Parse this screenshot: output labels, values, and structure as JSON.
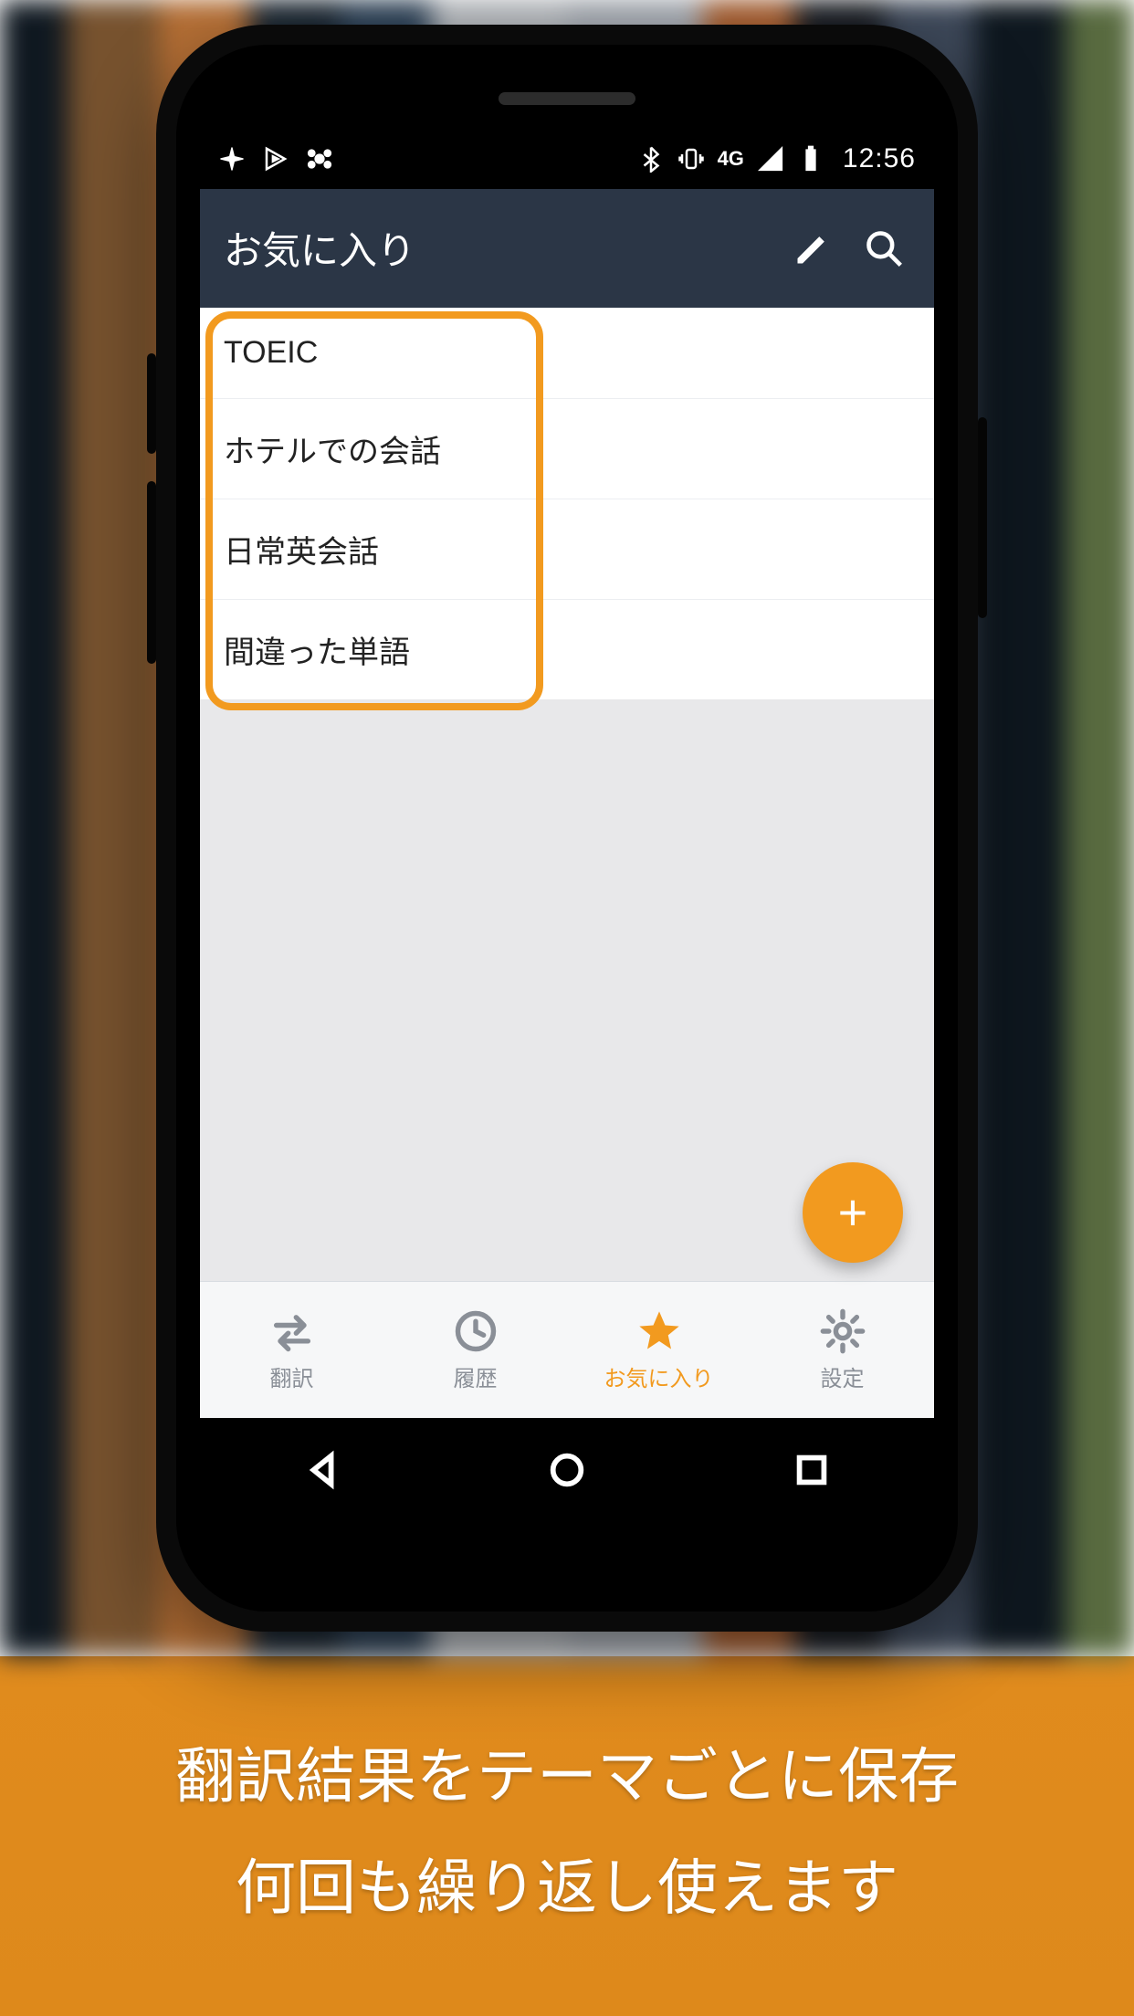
{
  "statusbar": {
    "network_label": "4G",
    "time": "12:56"
  },
  "appbar": {
    "title": "お気に入り"
  },
  "favorites": {
    "items": [
      {
        "label": "TOEIC"
      },
      {
        "label": "ホテルでの会話"
      },
      {
        "label": "日常英会話"
      },
      {
        "label": "間違った単語"
      }
    ]
  },
  "fab": {
    "label": "+"
  },
  "tabs": {
    "items": [
      {
        "key": "translate",
        "label": "翻訳",
        "active": false
      },
      {
        "key": "history",
        "label": "履歴",
        "active": false
      },
      {
        "key": "favorites",
        "label": "お気に入り",
        "active": true
      },
      {
        "key": "settings",
        "label": "設定",
        "active": false
      }
    ]
  },
  "caption": {
    "line1": "翻訳結果をテーマごとに保存",
    "line2": "何回も繰り返し使えます"
  },
  "colors": {
    "accent": "#f29a1f",
    "appbar_bg": "#2b3646"
  }
}
